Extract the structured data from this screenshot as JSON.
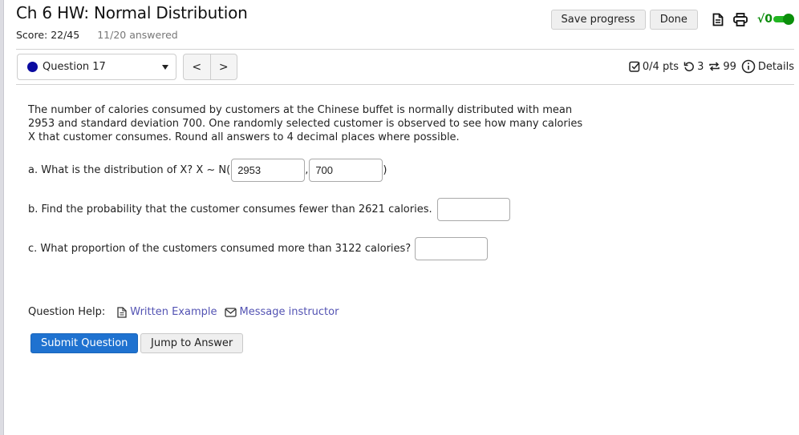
{
  "header": {
    "title": "Ch 6 HW: Normal Distribution",
    "score": "Score: 22/45",
    "answered": "11/20 answered",
    "save_label": "Save progress",
    "done_label": "Done",
    "icons": [
      "print-preview-icon",
      "printer-icon",
      "math-entry-toggle"
    ],
    "toggle_symbol": "√0",
    "toggle_state": "on",
    "toggle_color": "#0b8f0b"
  },
  "nav": {
    "question_selected": "Question 17",
    "status_dot_color": "#0a0aa0",
    "prev_label": "<",
    "next_label": ">"
  },
  "meta": {
    "points": "0/4 pts",
    "attempts": "3",
    "versions": "99",
    "details_label": "Details"
  },
  "question": {
    "body": "The number of calories consumed by customers at the Chinese buffet is normally distributed with mean 2953 and standard deviation 700. One randomly selected customer is observed to see how many calories X that customer consumes. Round all answers to 4 decimal places where possible.",
    "part_a": {
      "prompt": "a. What is the distribution of X? X ~ N(",
      "mean_value": "2953",
      "comma": ",",
      "sd_value": "700",
      "close": ")"
    },
    "part_b": {
      "prompt": "b. Find the probability that the customer consumes fewer than 2621 calories.",
      "value": ""
    },
    "part_c": {
      "prompt": "c. What proportion of the customers consumed more than 3122 calories?",
      "value": ""
    }
  },
  "help": {
    "label": "Question Help:",
    "written_example": "Written Example",
    "message_instructor": "Message instructor",
    "link_color": "#5353b3"
  },
  "actions": {
    "submit_label": "Submit Question",
    "jump_label": "Jump to Answer",
    "submit_color": "#1f72d0"
  }
}
